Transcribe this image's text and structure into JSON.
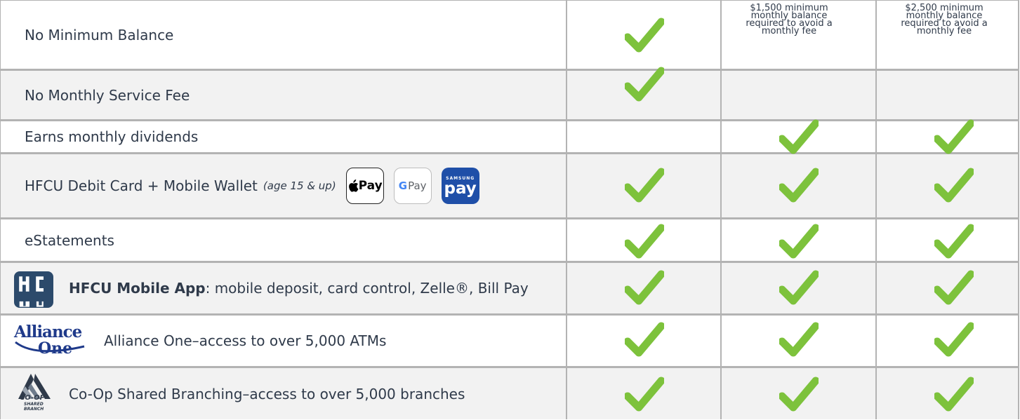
{
  "colors": {
    "check": "#7dc23c",
    "border": "#b3b3b3",
    "shaded": "#f2f2f2",
    "text": "#2f3a4a",
    "samsung": "#1f4fa8",
    "hfcu": "#2c4a6b",
    "alliance": "#1f3a8a"
  },
  "headers": {
    "col2": "$1,500 minimum\nmonthly balance\nrequired to avoid a\nmonthly fee",
    "col3": "$2,500 minimum\nmonthly balance\nrequired to avoid a\nmonthly fee"
  },
  "rows": [
    {
      "label": "No Minimum Balance",
      "checks": [
        true,
        false,
        false
      ]
    },
    {
      "label": "No Monthly Service Fee",
      "checks": [
        true,
        false,
        false
      ]
    },
    {
      "label": "Earns monthly dividends",
      "checks": [
        false,
        true,
        true
      ]
    },
    {
      "label": "HFCU Debit Card + Mobile Wallet",
      "note": "(age 15 & up)",
      "checks": [
        true,
        true,
        true
      ]
    },
    {
      "label": "eStatements",
      "checks": [
        true,
        true,
        true
      ]
    },
    {
      "label_strong": "HFCU Mobile App",
      "label": ": mobile deposit, card control, Zelle®, Bill Pay",
      "checks": [
        true,
        true,
        true
      ]
    },
    {
      "label": "Alliance One–access to over 5,000 ATMs",
      "checks": [
        true,
        true,
        true
      ]
    },
    {
      "label": "Co-Op Shared Branching–access to over 5,000 branches",
      "checks": [
        true,
        true,
        true
      ]
    }
  ],
  "wallets": {
    "apple": "Pay",
    "google": "Pay",
    "google_g": "G",
    "samsung_top": "SAMSUNG",
    "samsung_main": "pay"
  },
  "logos": {
    "alliance_top": "Alliance",
    "alliance_bottom": "One",
    "coop_top": "CO-OP",
    "coop_mid": "SHARED",
    "coop_bot": "BRANCH"
  }
}
